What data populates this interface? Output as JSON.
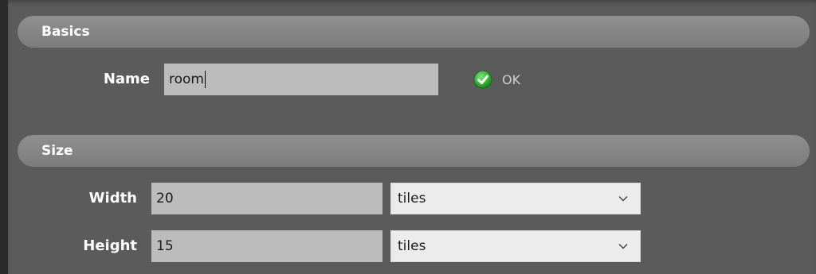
{
  "sections": {
    "basics": {
      "title": "Basics"
    },
    "size": {
      "title": "Size"
    }
  },
  "name_field": {
    "label": "Name",
    "value": "room",
    "status_icon": "check-circle-icon",
    "status_text": "OK",
    "status_color": "#2fb52f"
  },
  "width_field": {
    "label": "Width",
    "value": "20",
    "unit": "tiles"
  },
  "height_field": {
    "label": "Height",
    "value": "15",
    "unit": "tiles"
  },
  "icons": {
    "select_arrow": "chevron-down-icon"
  }
}
